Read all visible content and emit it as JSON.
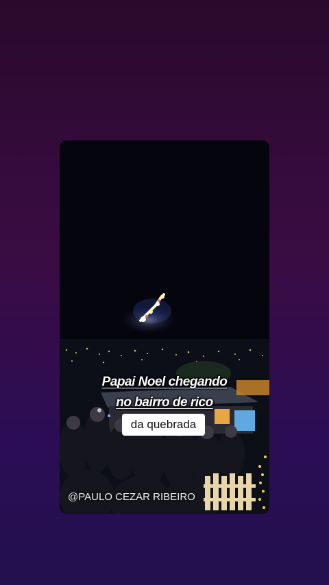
{
  "video": {
    "caption_line1": "Papai Noel chegando",
    "caption_line2": "no bairro de rico",
    "caption_highlight": "da quebrada",
    "credit": "@PAULO CEZAR RIBEIRO"
  },
  "colors": {
    "background_top": "#2a0a2c",
    "background_bottom": "#23104e",
    "caption_text": "#ffffff",
    "highlight_background": "#ffffff"
  }
}
